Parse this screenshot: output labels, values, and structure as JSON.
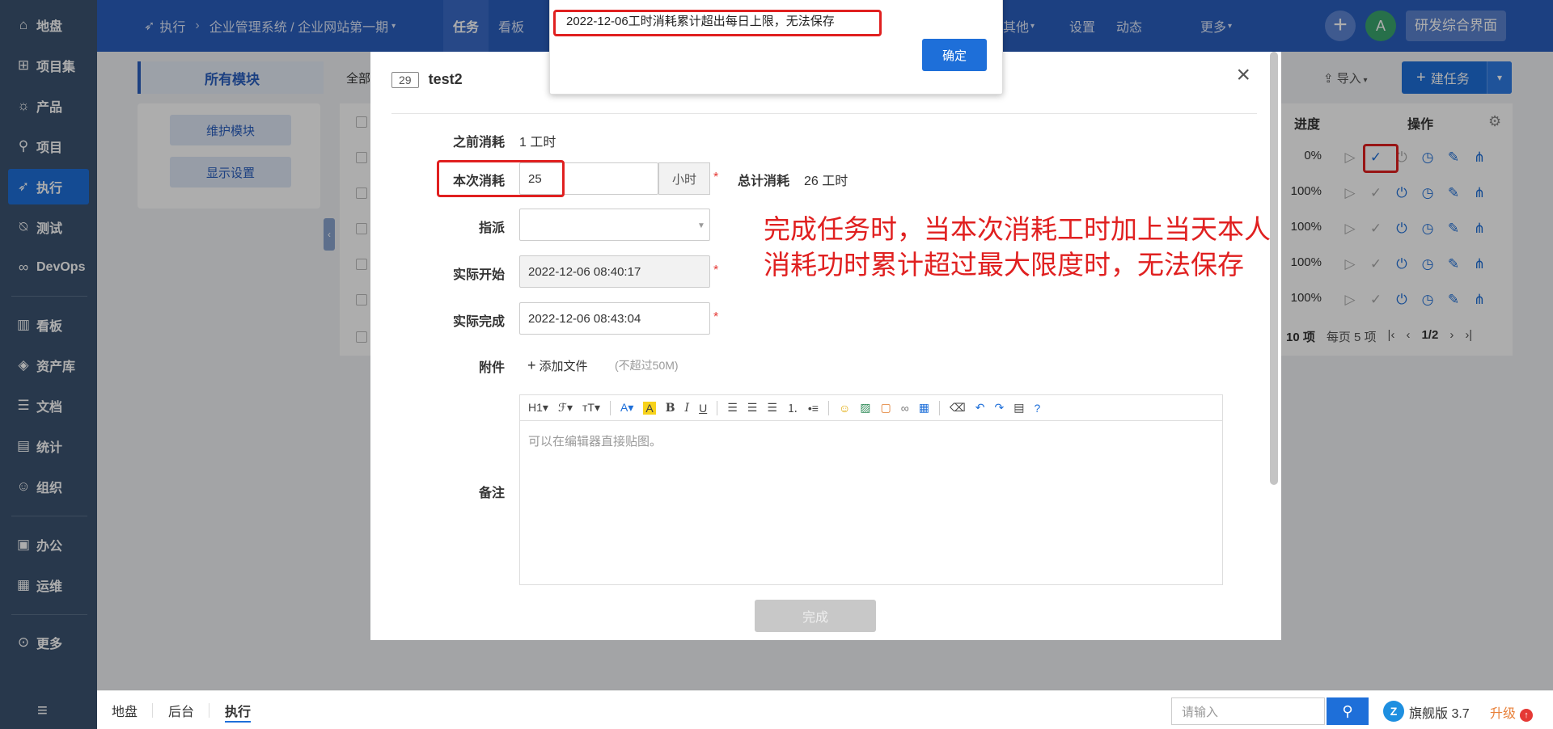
{
  "sidebar": {
    "items": [
      {
        "label": "地盘",
        "icon": "home-icon",
        "glyph": "⌂"
      },
      {
        "label": "项目集",
        "icon": "grid-icon",
        "glyph": "⊞"
      },
      {
        "label": "产品",
        "icon": "bulb-icon",
        "glyph": "☼"
      },
      {
        "label": "项目",
        "icon": "rocket-icon",
        "glyph": "⚲"
      },
      {
        "label": "执行",
        "icon": "run-icon",
        "glyph": "➶"
      },
      {
        "label": "测试",
        "icon": "test-icon",
        "glyph": "⍉"
      },
      {
        "label": "DevOps",
        "icon": "infinity-icon",
        "glyph": "∞"
      },
      {
        "label": "看板",
        "icon": "kanban-icon",
        "glyph": "▥"
      },
      {
        "label": "资产库",
        "icon": "diamond-icon",
        "glyph": "◈"
      },
      {
        "label": "文档",
        "icon": "doc-icon",
        "glyph": "☰"
      },
      {
        "label": "统计",
        "icon": "chart-icon",
        "glyph": "▤"
      },
      {
        "label": "组织",
        "icon": "user-icon",
        "glyph": "☺"
      },
      {
        "label": "办公",
        "icon": "office-icon",
        "glyph": "▣"
      },
      {
        "label": "运维",
        "icon": "ops-icon",
        "glyph": "▦"
      },
      {
        "label": "更多",
        "icon": "more-icon",
        "glyph": "⊙"
      }
    ],
    "collapse_glyph": "≡"
  },
  "topbar": {
    "breadcrumb_root": "执行",
    "breadcrumb_current": "企业管理系统 / 企业网站第一期",
    "tabs": {
      "task": "任务",
      "kanban": "看板",
      "other": "其他",
      "settings": "设置",
      "activity": "动态",
      "more": "更多"
    },
    "plus": "+",
    "avatar": "A",
    "workspace_button": "研发综合界面"
  },
  "background": {
    "module_tab": "所有模块",
    "maintain_modules": "维护模块",
    "display_settings": "显示设置",
    "all_label": "全部",
    "import_label": "导入",
    "new_task": "建任务",
    "col_progress": "进度",
    "col_actions": "操作",
    "rows": [
      {
        "progress": "0%"
      },
      {
        "progress": "100%"
      },
      {
        "progress": "100%"
      },
      {
        "progress": "100%"
      },
      {
        "progress": "100%"
      }
    ],
    "pager": {
      "total": "10 项",
      "per_page": "每页 5 项",
      "pages": "1/2"
    }
  },
  "modal": {
    "task_id": "29",
    "task_name": "test2",
    "close": "×",
    "prev_consumed_label": "之前消耗",
    "prev_consumed_value": "1 工时",
    "current_consumed_label": "本次消耗",
    "current_consumed_value": "25",
    "unit": "小时",
    "total_consumed_label": "总计消耗",
    "total_consumed_value": "26 工时",
    "assign_label": "指派",
    "actual_start_label": "实际开始",
    "actual_start_value": "2022-12-06 08:40:17",
    "actual_finish_label": "实际完成",
    "actual_finish_value": "2022-12-06 08:43:04",
    "attachment_label": "附件",
    "add_file": "添加文件",
    "file_hint": "(不超过50M)",
    "remark_label": "备注",
    "editor_placeholder": "可以在编辑器直接贴图。",
    "finish_button": "完成"
  },
  "annotation": {
    "line1": "完成任务时，当本次消耗工时加上当天本人",
    "line2": "消耗功时累计超过最大限度时，无法保存"
  },
  "alert": {
    "message": "2022-12-06工时消耗累计超出每日上限，无法保存",
    "ok_button": "确定"
  },
  "bottombar": {
    "links": {
      "dashboard": "地盘",
      "admin": "后台",
      "execution": "执行"
    },
    "search_placeholder": "请输入",
    "edition": "旗舰版 3.7",
    "upgrade": "升级"
  }
}
